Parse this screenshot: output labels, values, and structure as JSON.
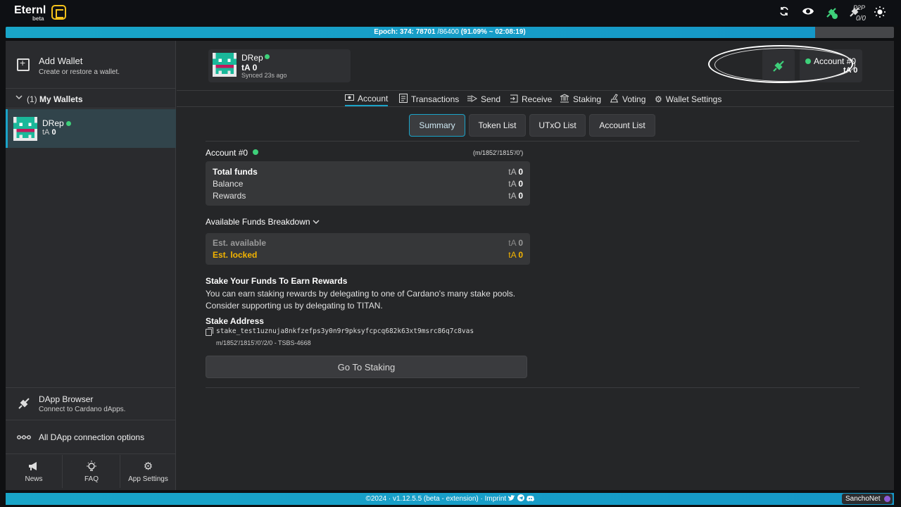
{
  "app": {
    "name": "Eternl",
    "badge": "beta"
  },
  "topbar": {
    "icons": [
      "sync-icon",
      "eye-icon",
      "dapp-connector-icon",
      "p2p-icon",
      "sun-icon"
    ],
    "p2p_label": "P2P",
    "p2p_value": "0/0"
  },
  "epoch": {
    "bold": "Epoch: 374: 78701",
    "light": " /86400 ",
    "tail": "(91.09%  ~ 02:08:19)",
    "progress": 0.9109
  },
  "sidebar": {
    "add_wallet_title": "Add Wallet",
    "add_wallet_sub": "Create or restore a wallet.",
    "my_wallets_count": "(1)",
    "my_wallets_label": "My Wallets",
    "wallet": {
      "name": "DRep",
      "currency": "tA",
      "balance": "0"
    },
    "dapp_browser_title": "DApp Browser",
    "dapp_browser_sub": "Connect to Cardano dApps.",
    "dapp_all_label": "All DApp connection options",
    "buttons": [
      {
        "label": "News",
        "icon": "megaphone-icon"
      },
      {
        "label": "FAQ",
        "icon": "lightbulb-icon"
      },
      {
        "label": "App Settings",
        "icon": "gear-icon"
      }
    ]
  },
  "header": {
    "wallet_name": "DRep",
    "currency": "tA",
    "balance": "0",
    "synced": "Synced 23s ago",
    "account_name": "Account #0",
    "account_balance": "tA 0"
  },
  "tabs": [
    "Account",
    "Transactions",
    "Send",
    "Receive",
    "Staking",
    "Voting",
    "Wallet Settings"
  ],
  "subtabs": [
    "Summary",
    "Token List",
    "UTxO List",
    "Account List"
  ],
  "summary": {
    "account_label": "Account #0",
    "account_path": "(m/1852'/1815'/0')",
    "funds": [
      {
        "label": "Total funds",
        "currency": "tA",
        "value": "0"
      },
      {
        "label": "Balance",
        "currency": "tA",
        "value": "0"
      },
      {
        "label": "Rewards",
        "currency": "tA",
        "value": "0"
      }
    ],
    "breakdown_label": "Available Funds Breakdown",
    "breakdown": [
      {
        "label": "Est. available",
        "currency": "tA",
        "value": "0"
      },
      {
        "label": "Est. locked",
        "currency": "tA",
        "value": "0"
      }
    ],
    "stake_title": "Stake Your Funds To Earn Rewards",
    "stake_desc_1": "You can earn staking rewards by delegating to one of Cardano's many stake pools.",
    "stake_desc_2": "Consider supporting us by delegating to TITAN.",
    "stake_address_title": "Stake Address",
    "stake_address": "stake_test1uznuja8nkfzefps3y0n9r9pksyfcpcq682k63xt9msrc86q7c8vas",
    "stake_address_path": "m/1852'/1815'/0'/2/0 - TSBS-4668",
    "goto_staking": "Go To Staking"
  },
  "footer": {
    "text": "©2024 · v1.12.5.5 (beta - extension) · Imprint",
    "network": "SanchoNet"
  },
  "colors": {
    "accent": "#1aa3c8",
    "status_green": "#3ed07a",
    "locked_yellow": "#f4b400",
    "logo_yellow": "#f4c21b"
  }
}
